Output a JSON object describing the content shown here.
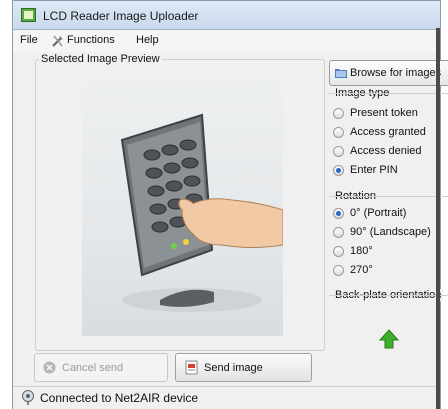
{
  "window": {
    "title": "LCD Reader Image Uploader"
  },
  "menu": {
    "file": "File",
    "functions": "Functions",
    "help": "Help"
  },
  "preview": {
    "label": "Selected Image Preview"
  },
  "browse": {
    "label": "Browse for images"
  },
  "image_type": {
    "label": "Image type",
    "options": [
      "Present token",
      "Access granted",
      "Access denied",
      "Enter PIN"
    ],
    "selected": "Enter PIN"
  },
  "rotation": {
    "label": "Rotation",
    "options": [
      "0° (Portrait)",
      "90° (Landscape)",
      "180°",
      "270°"
    ],
    "selected": "0° (Portrait)"
  },
  "backplate": {
    "label": "Back-plate orientation"
  },
  "buttons": {
    "cancel": "Cancel send",
    "send": "Send image"
  },
  "status": {
    "text": "Connected to Net2AIR device"
  },
  "colors": {
    "accent": "#2a66c9",
    "arrow": "#3fae2a"
  }
}
